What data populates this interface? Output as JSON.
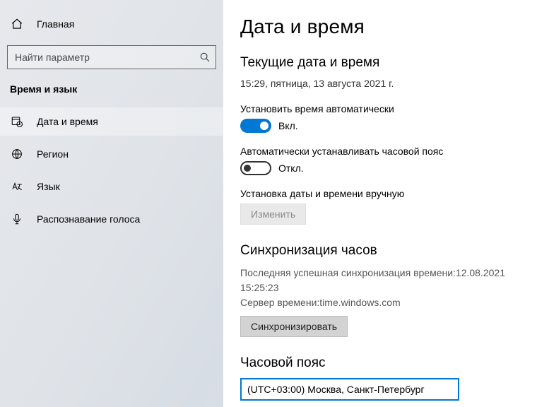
{
  "sidebar": {
    "home_label": "Главная",
    "search_placeholder": "Найти параметр",
    "category": "Время и язык",
    "items": [
      {
        "label": "Дата и время",
        "selected": true
      },
      {
        "label": "Регион",
        "selected": false
      },
      {
        "label": "Язык",
        "selected": false
      },
      {
        "label": "Распознавание голоса",
        "selected": false
      }
    ]
  },
  "main": {
    "title": "Дата и время",
    "current_heading": "Текущие дата и время",
    "current_value": "15:29, пятница, 13 августа 2021 г.",
    "auto_time": {
      "label": "Установить время автоматически",
      "state_label": "Вкл.",
      "on": true
    },
    "auto_tz": {
      "label": "Автоматически устанавливать часовой пояс",
      "state_label": "Откл.",
      "on": false
    },
    "manual_set": {
      "label": "Установка даты и времени вручную",
      "button": "Изменить"
    },
    "sync": {
      "heading": "Синхронизация часов",
      "last_sync_line": "Последняя успешная синхронизация времени:12.08.2021 15:25:23",
      "server_line": "Сервер времени:time.windows.com",
      "button": "Синхронизировать"
    },
    "timezone": {
      "heading": "Часовой пояс",
      "selected": "(UTC+03:00) Москва, Санкт-Петербург"
    }
  },
  "colors": {
    "accent": "#0078d4"
  }
}
